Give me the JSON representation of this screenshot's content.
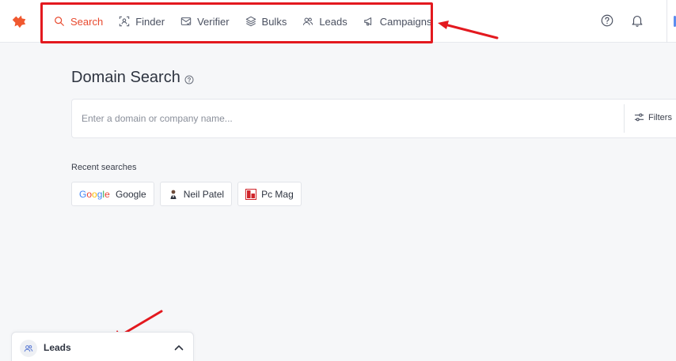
{
  "nav": {
    "items": [
      {
        "label": "Search",
        "icon": "search-icon",
        "active": true
      },
      {
        "label": "Finder",
        "icon": "finder-icon",
        "active": false
      },
      {
        "label": "Verifier",
        "icon": "verifier-icon",
        "active": false
      },
      {
        "label": "Bulks",
        "icon": "bulks-icon",
        "active": false
      },
      {
        "label": "Leads",
        "icon": "leads-icon",
        "active": false
      },
      {
        "label": "Campaigns",
        "icon": "campaigns-icon",
        "active": false
      }
    ]
  },
  "header_icons": [
    "help-icon",
    "bell-icon"
  ],
  "page": {
    "title": "Domain Search"
  },
  "search": {
    "placeholder": "Enter a domain or company name...",
    "value": "",
    "filters_label": "Filters"
  },
  "recent": {
    "label": "Recent searches",
    "items": [
      {
        "label": "Google",
        "icon": "google-logo"
      },
      {
        "label": "Neil Patel",
        "icon": "neil-patel-avatar"
      },
      {
        "label": "Pc Mag",
        "icon": "pcmag-logo"
      }
    ]
  },
  "leads_panel": {
    "label": "Leads"
  },
  "colors": {
    "accent": "#e8492e",
    "annotation_red": "#e3191f",
    "background": "#f6f7f9"
  }
}
